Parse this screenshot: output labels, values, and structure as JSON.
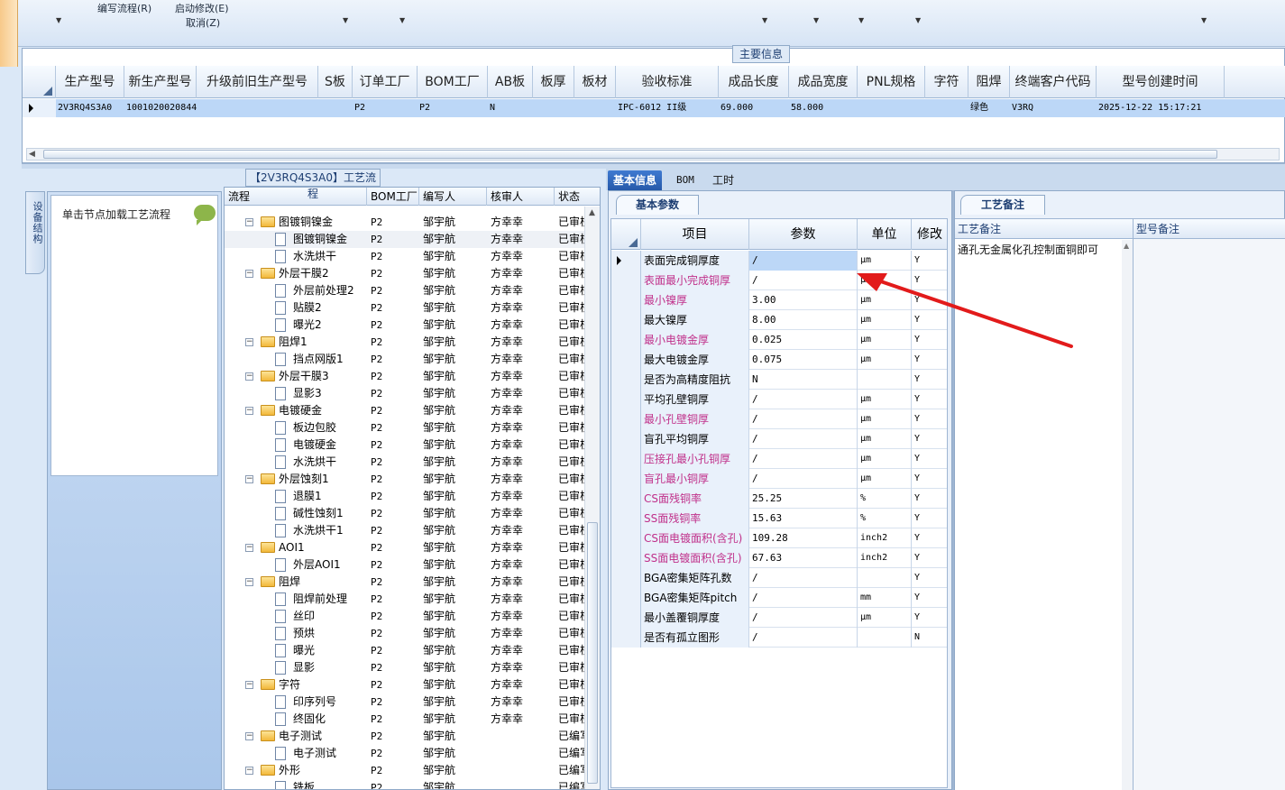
{
  "toolbar": {
    "edit_flow": "编写流程(R)",
    "start_modify": "启动修改(E)",
    "cancel": "取消(Z)"
  },
  "main_info": {
    "title": "主要信息",
    "columns": [
      "生产型号",
      "新生产型号",
      "升级前旧生产型号",
      "S板",
      "订单工厂",
      "BOM工厂",
      "AB板",
      "板厚",
      "板材",
      "验收标准",
      "成品长度",
      "成品宽度",
      "PNL规格",
      "字符",
      "阻焊",
      "终端客户代码",
      "型号创建时间"
    ],
    "row": [
      "2V3RQ4S3A0",
      "10010200208446",
      "",
      "",
      "P2",
      "P2",
      "N",
      "",
      "",
      "IPC-6012 II级",
      "69.000",
      "58.000",
      "",
      "",
      "绿色",
      "V3RQ",
      "2025-12-22 15:17:21"
    ]
  },
  "left": {
    "vtab": "设备结构",
    "load_node": "单击节点加载工艺流程"
  },
  "tree": {
    "title": "【2V3RQ4S3A0】工艺流程",
    "headers": {
      "name": "流程",
      "bom": "BOM工厂",
      "author": "编写人",
      "reviewer": "核审人",
      "status": "状态"
    },
    "rows": [
      {
        "name": "图镀铜镍金",
        "level": 1,
        "type": "folder",
        "bom": "P2",
        "author": "邹宇航",
        "reviewer": "方幸幸",
        "status": "已审核"
      },
      {
        "name": "图镀铜镍金",
        "level": 2,
        "type": "doc",
        "bom": "P2",
        "author": "邹宇航",
        "reviewer": "方幸幸",
        "status": "已审核"
      },
      {
        "name": "水洗烘干",
        "level": 2,
        "type": "doc",
        "bom": "P2",
        "author": "邹宇航",
        "reviewer": "方幸幸",
        "status": "已审核"
      },
      {
        "name": "外层干膜2",
        "level": 1,
        "type": "folder",
        "bom": "P2",
        "author": "邹宇航",
        "reviewer": "方幸幸",
        "status": "已审核"
      },
      {
        "name": "外层前处理2",
        "level": 2,
        "type": "doc",
        "bom": "P2",
        "author": "邹宇航",
        "reviewer": "方幸幸",
        "status": "已审核"
      },
      {
        "name": "贴膜2",
        "level": 2,
        "type": "doc",
        "bom": "P2",
        "author": "邹宇航",
        "reviewer": "方幸幸",
        "status": "已审核"
      },
      {
        "name": "曝光2",
        "level": 2,
        "type": "doc",
        "bom": "P2",
        "author": "邹宇航",
        "reviewer": "方幸幸",
        "status": "已审核"
      },
      {
        "name": "阻焊1",
        "level": 1,
        "type": "folder",
        "bom": "P2",
        "author": "邹宇航",
        "reviewer": "方幸幸",
        "status": "已审核"
      },
      {
        "name": "挡点网版1",
        "level": 2,
        "type": "doc",
        "bom": "P2",
        "author": "邹宇航",
        "reviewer": "方幸幸",
        "status": "已审核"
      },
      {
        "name": "外层干膜3",
        "level": 1,
        "type": "folder",
        "bom": "P2",
        "author": "邹宇航",
        "reviewer": "方幸幸",
        "status": "已审核"
      },
      {
        "name": "显影3",
        "level": 2,
        "type": "doc",
        "bom": "P2",
        "author": "邹宇航",
        "reviewer": "方幸幸",
        "status": "已审核"
      },
      {
        "name": "电镀硬金",
        "level": 1,
        "type": "folder",
        "bom": "P2",
        "author": "邹宇航",
        "reviewer": "方幸幸",
        "status": "已审核"
      },
      {
        "name": "板边包胶",
        "level": 2,
        "type": "doc",
        "bom": "P2",
        "author": "邹宇航",
        "reviewer": "方幸幸",
        "status": "已审核"
      },
      {
        "name": "电镀硬金",
        "level": 2,
        "type": "doc",
        "bom": "P2",
        "author": "邹宇航",
        "reviewer": "方幸幸",
        "status": "已审核"
      },
      {
        "name": "水洗烘干",
        "level": 2,
        "type": "doc",
        "bom": "P2",
        "author": "邹宇航",
        "reviewer": "方幸幸",
        "status": "已审核"
      },
      {
        "name": "外层蚀刻1",
        "level": 1,
        "type": "folder",
        "bom": "P2",
        "author": "邹宇航",
        "reviewer": "方幸幸",
        "status": "已审核"
      },
      {
        "name": "退膜1",
        "level": 2,
        "type": "doc",
        "bom": "P2",
        "author": "邹宇航",
        "reviewer": "方幸幸",
        "status": "已审核"
      },
      {
        "name": "碱性蚀刻1",
        "level": 2,
        "type": "doc",
        "bom": "P2",
        "author": "邹宇航",
        "reviewer": "方幸幸",
        "status": "已审核"
      },
      {
        "name": "水洗烘干1",
        "level": 2,
        "type": "doc",
        "bom": "P2",
        "author": "邹宇航",
        "reviewer": "方幸幸",
        "status": "已审核"
      },
      {
        "name": "AOI1",
        "level": 1,
        "type": "folder",
        "bom": "P2",
        "author": "邹宇航",
        "reviewer": "方幸幸",
        "status": "已审核"
      },
      {
        "name": "外层AOI1",
        "level": 2,
        "type": "doc",
        "bom": "P2",
        "author": "邹宇航",
        "reviewer": "方幸幸",
        "status": "已审核"
      },
      {
        "name": "阻焊",
        "level": 1,
        "type": "folder",
        "bom": "P2",
        "author": "邹宇航",
        "reviewer": "方幸幸",
        "status": "已审核"
      },
      {
        "name": "阻焊前处理",
        "level": 2,
        "type": "doc",
        "bom": "P2",
        "author": "邹宇航",
        "reviewer": "方幸幸",
        "status": "已审核"
      },
      {
        "name": "丝印",
        "level": 2,
        "type": "doc",
        "bom": "P2",
        "author": "邹宇航",
        "reviewer": "方幸幸",
        "status": "已审核"
      },
      {
        "name": "预烘",
        "level": 2,
        "type": "doc",
        "bom": "P2",
        "author": "邹宇航",
        "reviewer": "方幸幸",
        "status": "已审核"
      },
      {
        "name": "曝光",
        "level": 2,
        "type": "doc",
        "bom": "P2",
        "author": "邹宇航",
        "reviewer": "方幸幸",
        "status": "已审核"
      },
      {
        "name": "显影",
        "level": 2,
        "type": "doc",
        "bom": "P2",
        "author": "邹宇航",
        "reviewer": "方幸幸",
        "status": "已审核"
      },
      {
        "name": "字符",
        "level": 1,
        "type": "folder",
        "bom": "P2",
        "author": "邹宇航",
        "reviewer": "方幸幸",
        "status": "已审核"
      },
      {
        "name": "印序列号",
        "level": 2,
        "type": "doc",
        "bom": "P2",
        "author": "邹宇航",
        "reviewer": "方幸幸",
        "status": "已审核"
      },
      {
        "name": "终固化",
        "level": 2,
        "type": "doc",
        "bom": "P2",
        "author": "邹宇航",
        "reviewer": "方幸幸",
        "status": "已审核"
      },
      {
        "name": "电子测试",
        "level": 1,
        "type": "folder",
        "bom": "P2",
        "author": "邹宇航",
        "reviewer": "",
        "status": "已编写"
      },
      {
        "name": "电子测试",
        "level": 2,
        "type": "doc",
        "bom": "P2",
        "author": "邹宇航",
        "reviewer": "",
        "status": "已编写"
      },
      {
        "name": "外形",
        "level": 1,
        "type": "folder",
        "bom": "P2",
        "author": "邹宇航",
        "reviewer": "",
        "status": "已编写"
      },
      {
        "name": "铣板",
        "level": 2,
        "type": "doc",
        "bom": "P2",
        "author": "邹宇航",
        "reviewer": "",
        "status": "已编写"
      }
    ]
  },
  "detail_tabs": [
    "基本信息",
    "BOM",
    "工时"
  ],
  "params": {
    "title": "基本参数",
    "headers": {
      "item": "项目",
      "param": "参数",
      "unit": "单位",
      "mod": "修改"
    },
    "rows": [
      {
        "item": "表面完成铜厚度",
        "param": "/",
        "unit": "μm",
        "mod": "Y",
        "pink": false
      },
      {
        "item": "表面最小完成铜厚",
        "param": "/",
        "unit": "μm",
        "mod": "Y",
        "pink": true
      },
      {
        "item": "最小镍厚",
        "param": "3.00",
        "unit": "μm",
        "mod": "Y",
        "pink": true
      },
      {
        "item": "最大镍厚",
        "param": "8.00",
        "unit": "μm",
        "mod": "Y",
        "pink": false
      },
      {
        "item": "最小电镀金厚",
        "param": "0.025",
        "unit": "μm",
        "mod": "Y",
        "pink": true
      },
      {
        "item": "最大电镀金厚",
        "param": "0.075",
        "unit": "μm",
        "mod": "Y",
        "pink": false
      },
      {
        "item": "是否为高精度阻抗",
        "param": "N",
        "unit": "",
        "mod": "Y",
        "pink": false
      },
      {
        "item": "平均孔壁铜厚",
        "param": "/",
        "unit": "μm",
        "mod": "Y",
        "pink": false
      },
      {
        "item": "最小孔壁铜厚",
        "param": "/",
        "unit": "μm",
        "mod": "Y",
        "pink": true
      },
      {
        "item": "盲孔平均铜厚",
        "param": "/",
        "unit": "μm",
        "mod": "Y",
        "pink": false
      },
      {
        "item": "压接孔最小孔铜厚",
        "param": "/",
        "unit": "μm",
        "mod": "Y",
        "pink": true
      },
      {
        "item": "盲孔最小铜厚",
        "param": "/",
        "unit": "μm",
        "mod": "Y",
        "pink": true
      },
      {
        "item": "CS面残铜率",
        "param": "25.25",
        "unit": "%",
        "mod": "Y",
        "pink": true
      },
      {
        "item": "SS面残铜率",
        "param": "15.63",
        "unit": "%",
        "mod": "Y",
        "pink": true
      },
      {
        "item": "CS面电镀面积(含孔)",
        "param": "109.28",
        "unit": "inch2",
        "mod": "Y",
        "pink": true
      },
      {
        "item": "SS面电镀面积(含孔)",
        "param": "67.63",
        "unit": "inch2",
        "mod": "Y",
        "pink": true
      },
      {
        "item": "BGA密集矩阵孔数",
        "param": "/",
        "unit": "",
        "mod": "Y",
        "pink": false
      },
      {
        "item": "BGA密集矩阵pitch",
        "param": "/",
        "unit": "mm",
        "mod": "Y",
        "pink": false
      },
      {
        "item": "最小盖覆铜厚度",
        "param": "/",
        "unit": "μm",
        "mod": "Y",
        "pink": false
      },
      {
        "item": "是否有孤立图形",
        "param": "/",
        "unit": "",
        "mod": "N",
        "pink": false
      }
    ]
  },
  "notes": {
    "title": "工艺备注",
    "col1": "工艺备注",
    "col2": "型号备注",
    "text": "通孔无金属化孔控制面铜即可"
  },
  "colors": {
    "accent": "#2659a9",
    "selection": "#bcd7f7",
    "pink": "#c0308a",
    "annotation": "#e21b1b"
  }
}
